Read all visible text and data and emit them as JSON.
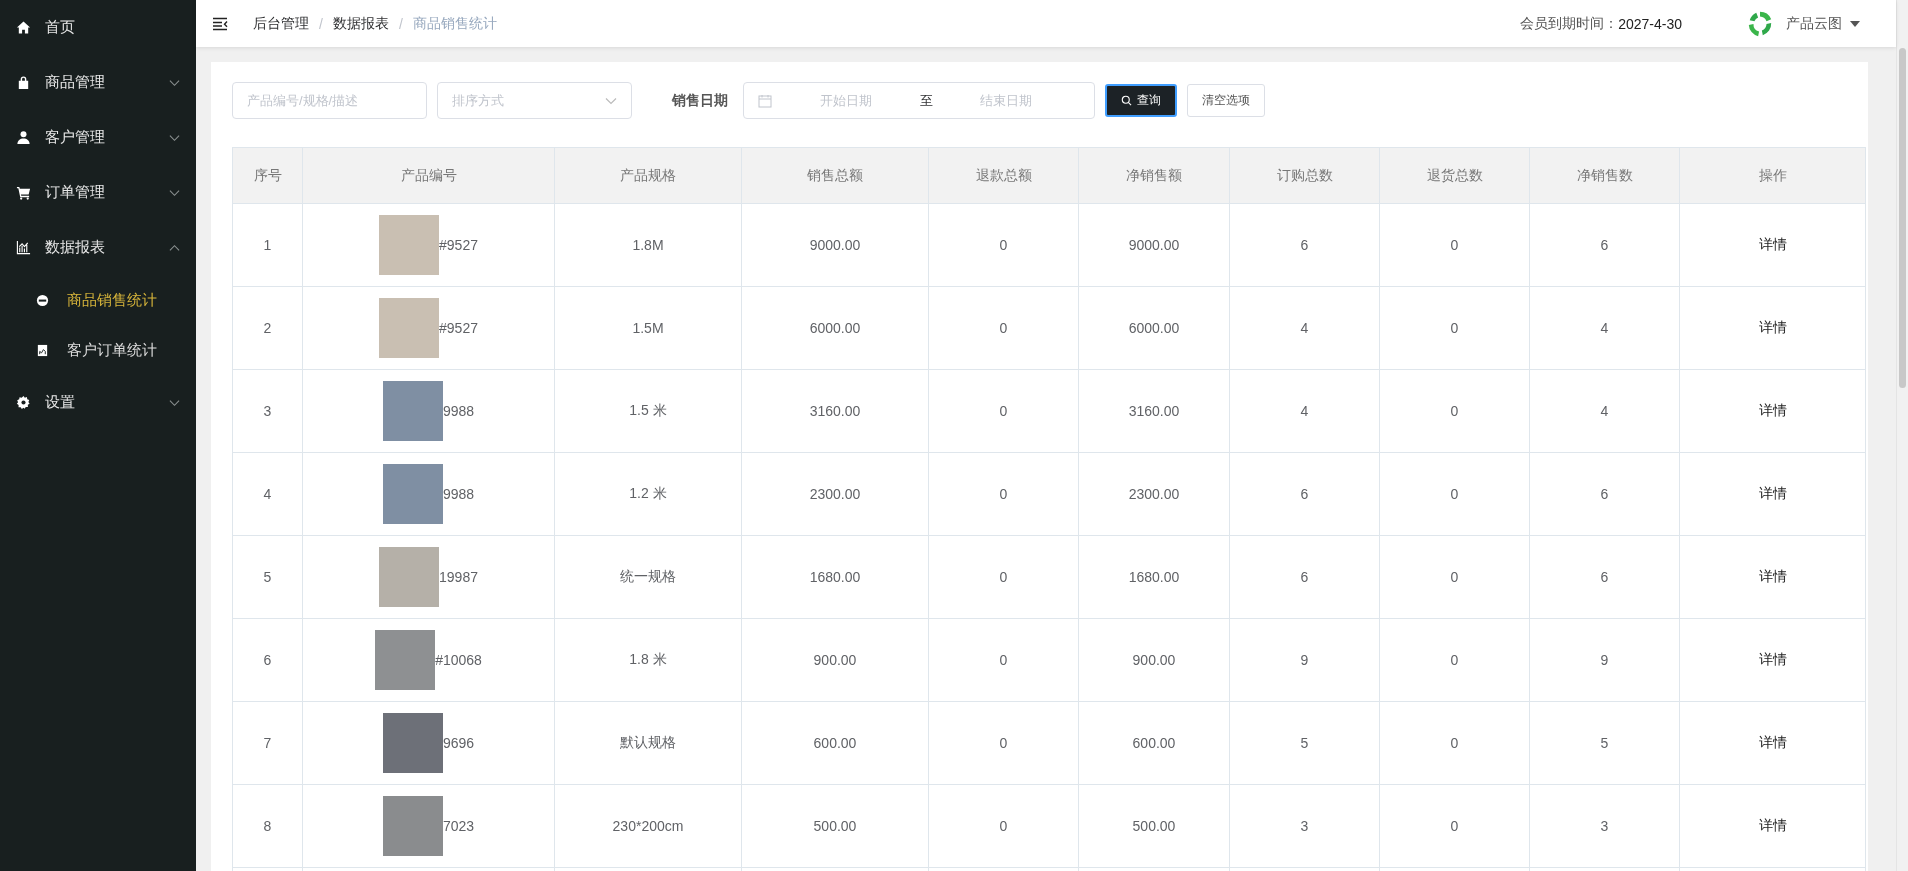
{
  "sidebar": {
    "items": [
      {
        "label": "首页"
      },
      {
        "label": "商品管理",
        "expanded": false
      },
      {
        "label": "客户管理",
        "expanded": false
      },
      {
        "label": "订单管理",
        "expanded": false
      },
      {
        "label": "数据报表",
        "expanded": true,
        "children": [
          {
            "label": "商品销售统计",
            "selected": true
          },
          {
            "label": "客户订单统计",
            "selected": false
          }
        ]
      },
      {
        "label": "设置",
        "expanded": false
      }
    ]
  },
  "header": {
    "breadcrumb": [
      "后台管理",
      "数据报表",
      "商品销售统计"
    ],
    "breadcrumb_separator": "/",
    "expiry_label": "会员到期时间：",
    "expiry_date": "2027-4-30",
    "user": "产品云图"
  },
  "filters": {
    "search": {
      "placeholder": "产品编号/规格/描述"
    },
    "sort": {
      "placeholder": "排序方式"
    },
    "date_label": "销售日期",
    "date_start": {
      "placeholder": "开始日期"
    },
    "date_separator": "至",
    "date_end": {
      "placeholder": "结束日期"
    },
    "query_button": "查询",
    "clear_button": "清空选项"
  },
  "table": {
    "columns": [
      "序号",
      "产品编号",
      "产品规格",
      "销售总额",
      "退款总额",
      "净销售额",
      "订购总数",
      "退货总数",
      "净销售数",
      "操作"
    ],
    "rows": [
      {
        "index": "1",
        "code": "#9527",
        "spec": "1.8M",
        "sales": "9000.00",
        "refund": "0",
        "net_sales": "9000.00",
        "ordered": "6",
        "returned": "0",
        "net_count": "6",
        "action": "详情"
      },
      {
        "index": "2",
        "code": "#9527",
        "spec": "1.5M",
        "sales": "6000.00",
        "refund": "0",
        "net_sales": "6000.00",
        "ordered": "4",
        "returned": "0",
        "net_count": "4",
        "action": "详情"
      },
      {
        "index": "3",
        "code": "9988",
        "spec": "1.5 米",
        "sales": "3160.00",
        "refund": "0",
        "net_sales": "3160.00",
        "ordered": "4",
        "returned": "0",
        "net_count": "4",
        "action": "详情"
      },
      {
        "index": "4",
        "code": "9988",
        "spec": "1.2 米",
        "sales": "2300.00",
        "refund": "0",
        "net_sales": "2300.00",
        "ordered": "6",
        "returned": "0",
        "net_count": "6",
        "action": "详情"
      },
      {
        "index": "5",
        "code": "19987",
        "spec": "统一规格",
        "sales": "1680.00",
        "refund": "0",
        "net_sales": "1680.00",
        "ordered": "6",
        "returned": "0",
        "net_count": "6",
        "action": "详情"
      },
      {
        "index": "6",
        "code": "#10068",
        "spec": "1.8 米",
        "sales": "900.00",
        "refund": "0",
        "net_sales": "900.00",
        "ordered": "9",
        "returned": "0",
        "net_count": "9",
        "action": "详情"
      },
      {
        "index": "7",
        "code": "9696",
        "spec": "默认规格",
        "sales": "600.00",
        "refund": "0",
        "net_sales": "600.00",
        "ordered": "5",
        "returned": "0",
        "net_count": "5",
        "action": "详情"
      },
      {
        "index": "8",
        "code": "7023",
        "spec": "230*200cm",
        "sales": "500.00",
        "refund": "0",
        "net_sales": "500.00",
        "ordered": "3",
        "returned": "0",
        "net_count": "3",
        "action": "详情"
      }
    ]
  }
}
